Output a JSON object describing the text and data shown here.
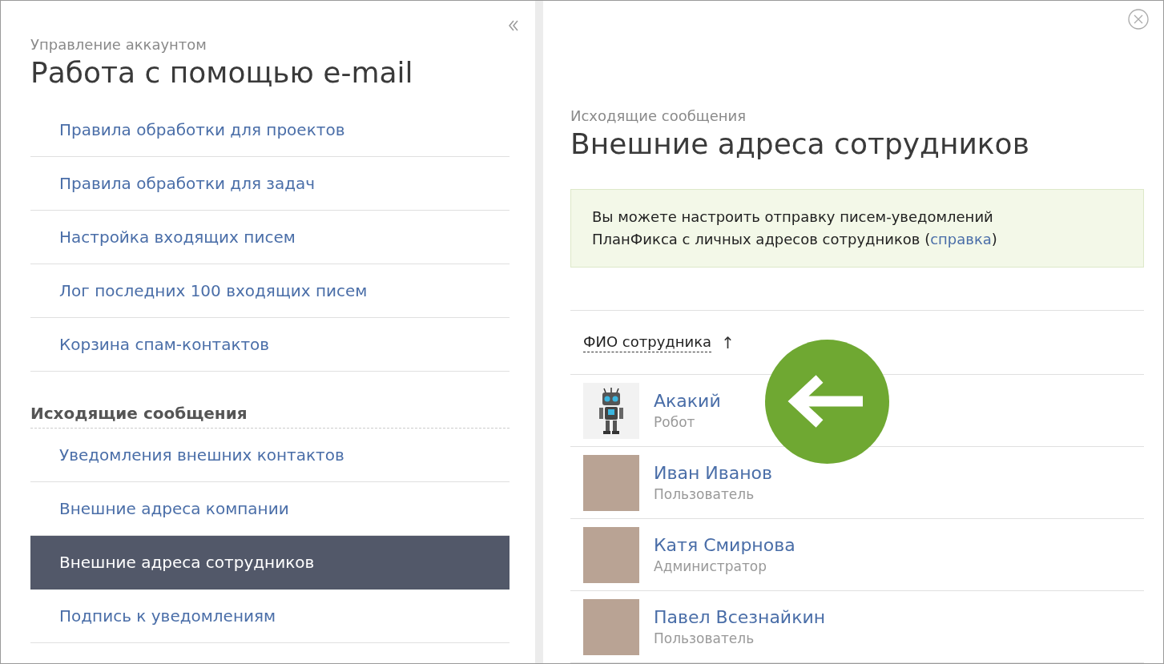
{
  "sidebar": {
    "subtitle": "Управление аккаунтом",
    "title": "Работа с помощью e-mail",
    "groups": [
      {
        "items": [
          {
            "label": "Правила обработки для проектов",
            "selected": false
          },
          {
            "label": "Правила обработки для задач",
            "selected": false
          },
          {
            "label": "Настройка входящих писем",
            "selected": false
          },
          {
            "label": "Лог последних 100 входящих писем",
            "selected": false
          },
          {
            "label": "Корзина спам-контактов",
            "selected": false
          }
        ]
      },
      {
        "heading": "Исходящие сообщения",
        "items": [
          {
            "label": "Уведомления внешних контактов",
            "selected": false
          },
          {
            "label": "Внешние адреса компании",
            "selected": false
          },
          {
            "label": "Внешние адреса сотрудников",
            "selected": true
          },
          {
            "label": "Подпись к уведомлениям",
            "selected": false
          }
        ]
      }
    ]
  },
  "main": {
    "subtitle": "Исходящие сообщения",
    "title": "Внешние адреса сотрудников",
    "info": {
      "text": "Вы можете настроить отправку писем-уведомлений ПланФикса с личных адресов сотрудников (",
      "link": "справка",
      "text_after": ")"
    },
    "table": {
      "column": "ФИО сотрудника",
      "sort": "↑",
      "rows": [
        {
          "name": "Акакий",
          "role": "Робот",
          "kind": "robot"
        },
        {
          "name": "Иван Иванов",
          "role": "Пользователь",
          "kind": "user"
        },
        {
          "name": "Катя Смирнова",
          "role": "Администратор",
          "kind": "user"
        },
        {
          "name": "Павел Всезнайкин",
          "role": "Пользователь",
          "kind": "user"
        }
      ]
    }
  }
}
